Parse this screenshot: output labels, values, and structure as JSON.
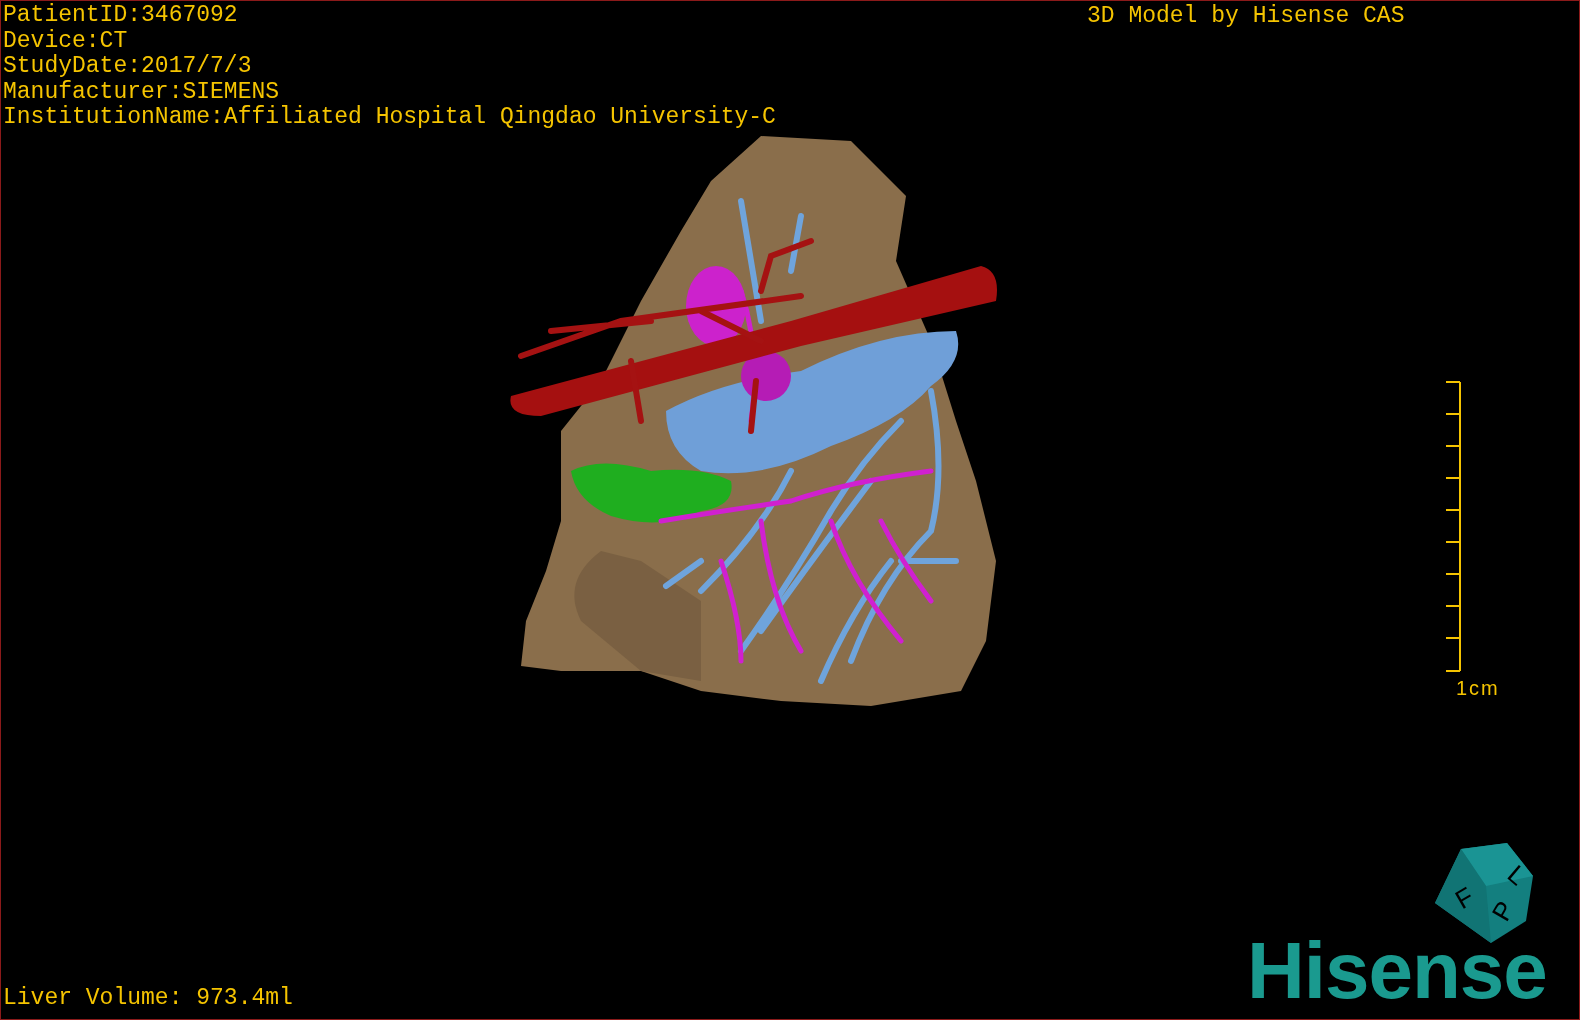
{
  "patient_info": [
    "PatientID:3467092",
    "Device:CT",
    "StudyDate:2017/7/3",
    "Manufacturer:SIEMENS",
    "InstitutionName:Affiliated Hospital Qingdao University-C"
  ],
  "model_credit": "3D Model by Hisense CAS",
  "scale_bar": {
    "label": "1cm"
  },
  "orientation_cube": {
    "faces": [
      "F",
      "L",
      "P"
    ]
  },
  "brand_logo": "Hisense",
  "liver_volume": "Liver Volume: 973.4ml"
}
